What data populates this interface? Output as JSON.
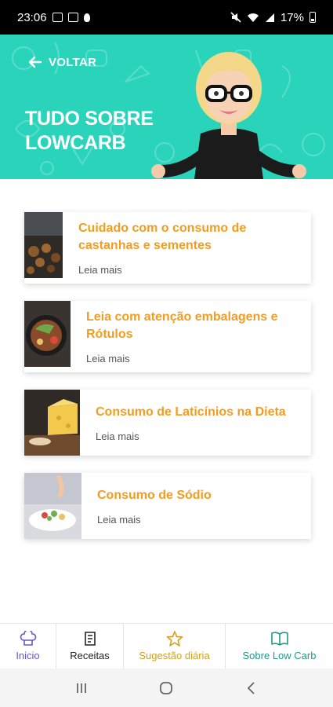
{
  "status_bar": {
    "time": "23:06",
    "battery": "17%"
  },
  "header": {
    "back_label": "VOLTAR",
    "title": "TUDO SOBRE\nLOWCARB",
    "background_color": "#2ad4bb"
  },
  "articles": [
    {
      "title": "Cuidado com o consumo de castanhas e sementes",
      "link": "Leia mais"
    },
    {
      "title": "Leia com atenção embalagens e Rótulos",
      "link": "Leia mais"
    },
    {
      "title": "Consumo de Laticínios na Dieta",
      "link": "Leia mais"
    },
    {
      "title": "Consumo de Sódio",
      "link": "Leia mais"
    }
  ],
  "bottom_nav": [
    {
      "label": "Inicio",
      "icon": "chef-hat-icon",
      "color": "#6b57c9"
    },
    {
      "label": "Receitas",
      "icon": "recipe-book-icon",
      "color": "#222222"
    },
    {
      "label": "Sugestão diária",
      "icon": "star-icon",
      "color": "#d3a01b"
    },
    {
      "label": "Sobre Low Carb",
      "icon": "open-book-icon",
      "color": "#1f9a8a"
    }
  ],
  "accent_color": "#f39c1f"
}
